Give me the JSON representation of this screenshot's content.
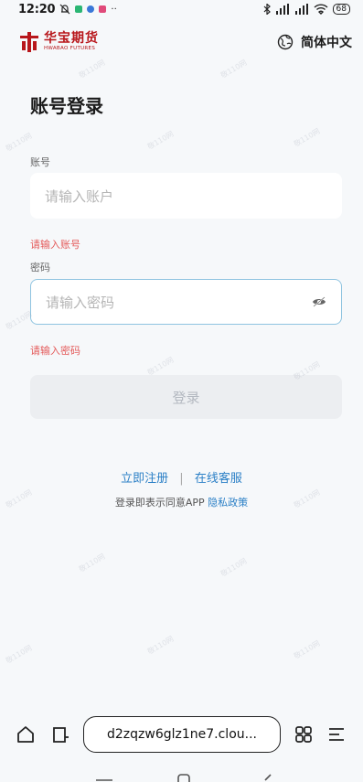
{
  "status": {
    "time": "12:20",
    "battery": "68"
  },
  "header": {
    "logo_cn": "华宝期货",
    "logo_en": "HWABAO FUTURES",
    "lang_label": "简体中文"
  },
  "form": {
    "title": "账号登录",
    "account_label": "账号",
    "account_placeholder": "请输入账户",
    "account_error": "请输入账号",
    "password_label": "密码",
    "password_placeholder": "请输入密码",
    "password_error": "请输入密码",
    "login_label": "登录"
  },
  "links": {
    "register": "立即注册",
    "separator": "|",
    "support": "在线客服",
    "agree_prefix": "登录即表示同意APP",
    "privacy": "隐私政策"
  },
  "browser": {
    "url": "d2zqzw6glz1ne7.clou..."
  },
  "watermark_text": "敬110网",
  "colors": {
    "brand_red": "#b8161b",
    "link_blue": "#2a7fc6",
    "error_red": "#e45a5a",
    "focus_border": "#8fc4e0"
  }
}
